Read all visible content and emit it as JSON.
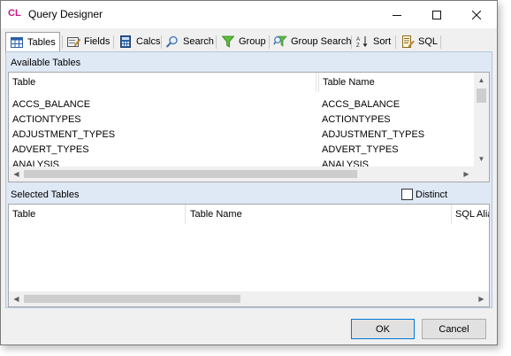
{
  "window": {
    "title": "Query Designer",
    "app_icon_text": "CL"
  },
  "titlebar_buttons": {
    "minimize": "—",
    "maximize": "☐",
    "close": "✕"
  },
  "tabs": [
    {
      "label": "Tables",
      "icon": "table-icon"
    },
    {
      "label": "Fields",
      "icon": "fields-icon"
    },
    {
      "label": "Calcs",
      "icon": "calculator-icon"
    },
    {
      "label": "Search",
      "icon": "magnifier-icon"
    },
    {
      "label": "Group",
      "icon": "filter-funnel-icon"
    },
    {
      "label": "Group Search",
      "icon": "group-search-icon"
    },
    {
      "label": "Sort",
      "icon": "sort-az-icon"
    },
    {
      "label": "SQL",
      "icon": "sql-script-icon"
    }
  ],
  "available": {
    "label": "Available Tables",
    "columns": [
      "Table",
      "Table Name"
    ],
    "rows": [
      [
        "ACCS_BALANCE",
        "ACCS_BALANCE"
      ],
      [
        "ACTIONTYPES",
        "ACTIONTYPES"
      ],
      [
        "ADJUSTMENT_TYPES",
        "ADJUSTMENT_TYPES"
      ],
      [
        "ADVERT_TYPES",
        "ADVERT_TYPES"
      ],
      [
        "ANALYSIS",
        "ANALYSIS"
      ]
    ]
  },
  "selected": {
    "label": "Selected Tables",
    "distinct_label": "Distinct",
    "distinct_checked": false,
    "columns": [
      "Table",
      "Table Name",
      "SQL Alias"
    ]
  },
  "buttons": {
    "ok": "OK",
    "cancel": "Cancel"
  }
}
